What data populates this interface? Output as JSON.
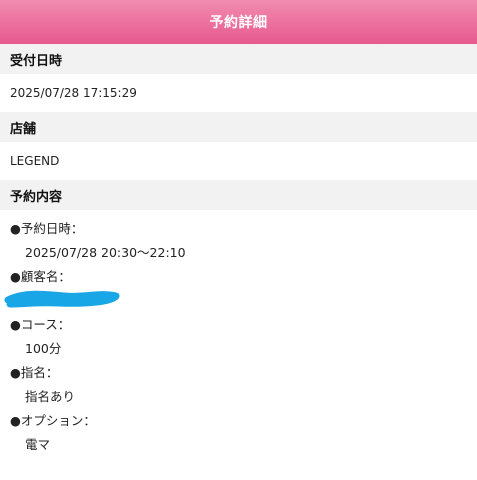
{
  "header": {
    "title": "予約詳細"
  },
  "reception": {
    "label": "受付日時",
    "value": "2025/07/28 17:15:29"
  },
  "store": {
    "label": "店舗",
    "value": "LEGEND"
  },
  "reservation": {
    "label": "予約内容",
    "items": [
      {
        "label": "●予約日時：",
        "value": "2025/07/28 20:30〜22:10"
      },
      {
        "label": "●顧客名：",
        "value": ""
      },
      {
        "label": "●コース：",
        "value": "100分"
      },
      {
        "label": "●指名：",
        "value": "指名あり"
      },
      {
        "label": "●オプション：",
        "value": "電マ"
      }
    ]
  },
  "colors": {
    "header_pink": "#ec6f9d",
    "section_bg": "#f2f2f2",
    "redaction_blue": "#19a6e6"
  }
}
